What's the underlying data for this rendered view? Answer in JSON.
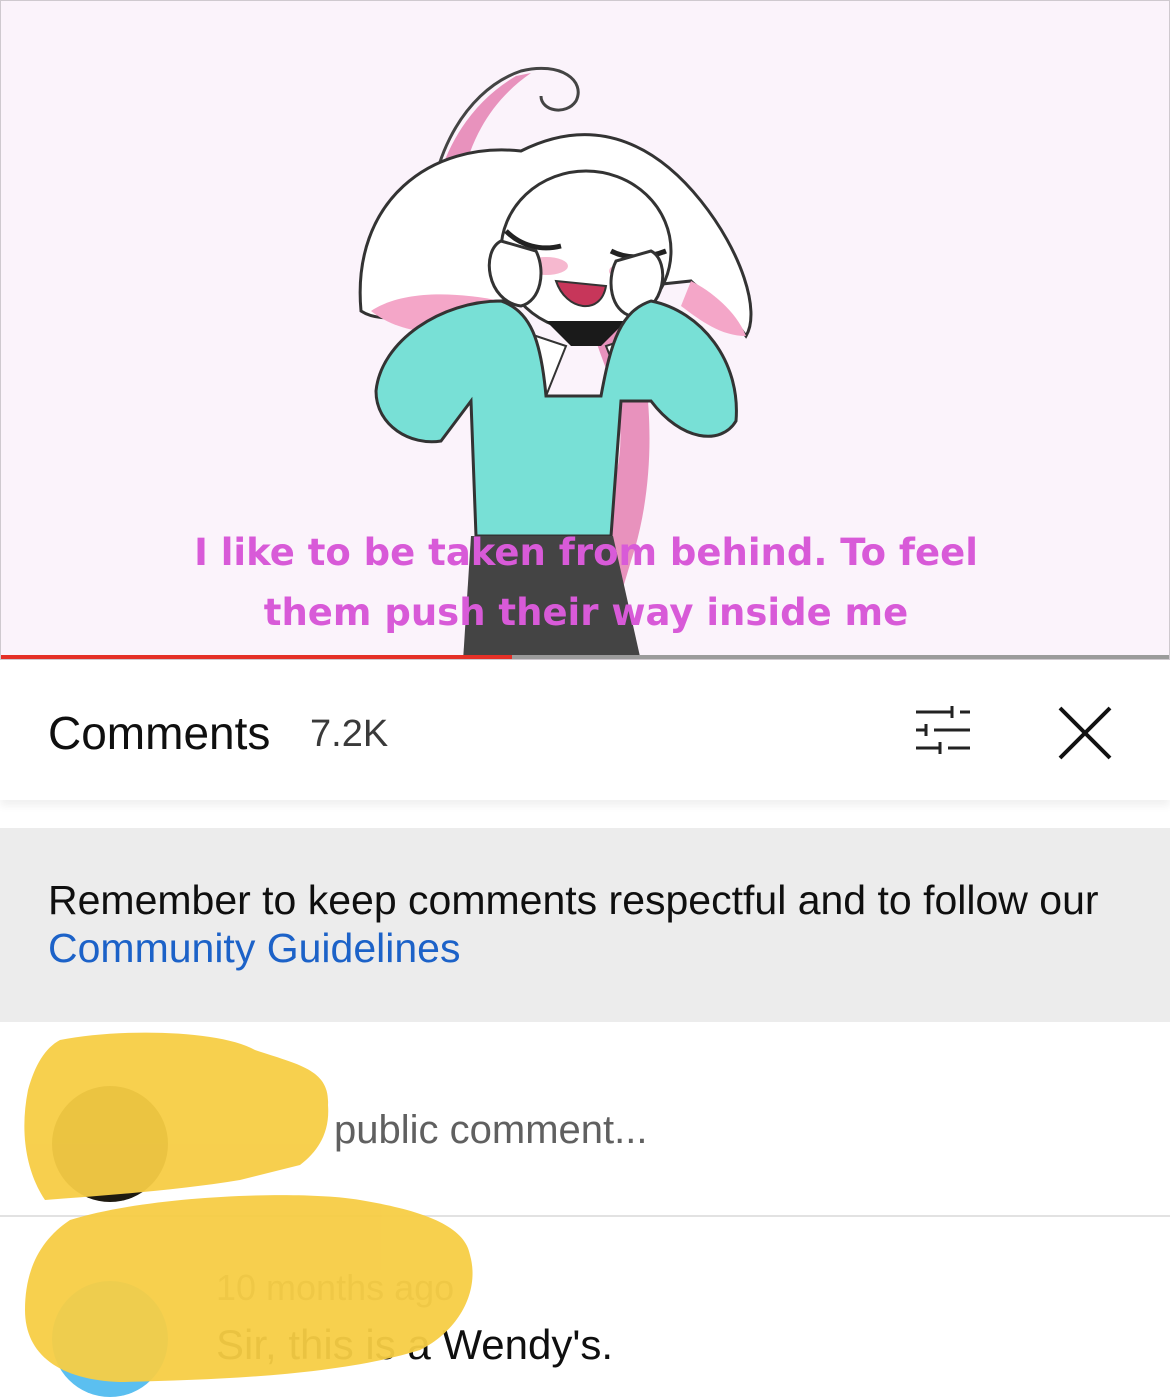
{
  "video": {
    "subtitle_line1": "I like to be taken from behind. To feel",
    "subtitle_line2": "them push their way inside me",
    "progress": 0.437
  },
  "comments_panel": {
    "title": "Comments",
    "count": "7.2K"
  },
  "notice": {
    "text": "Remember to keep comments respectful and to follow our ",
    "link": "Community Guidelines"
  },
  "add_comment": {
    "placeholder": "public comment..."
  },
  "comment": {
    "time": "10 months ago",
    "text": "Sir, this is a Wendy's."
  },
  "colors": {
    "progress": "#e53027",
    "link": "#1c62c8",
    "subtitle": "#d85ad8",
    "redaction": "#f7cd45"
  }
}
